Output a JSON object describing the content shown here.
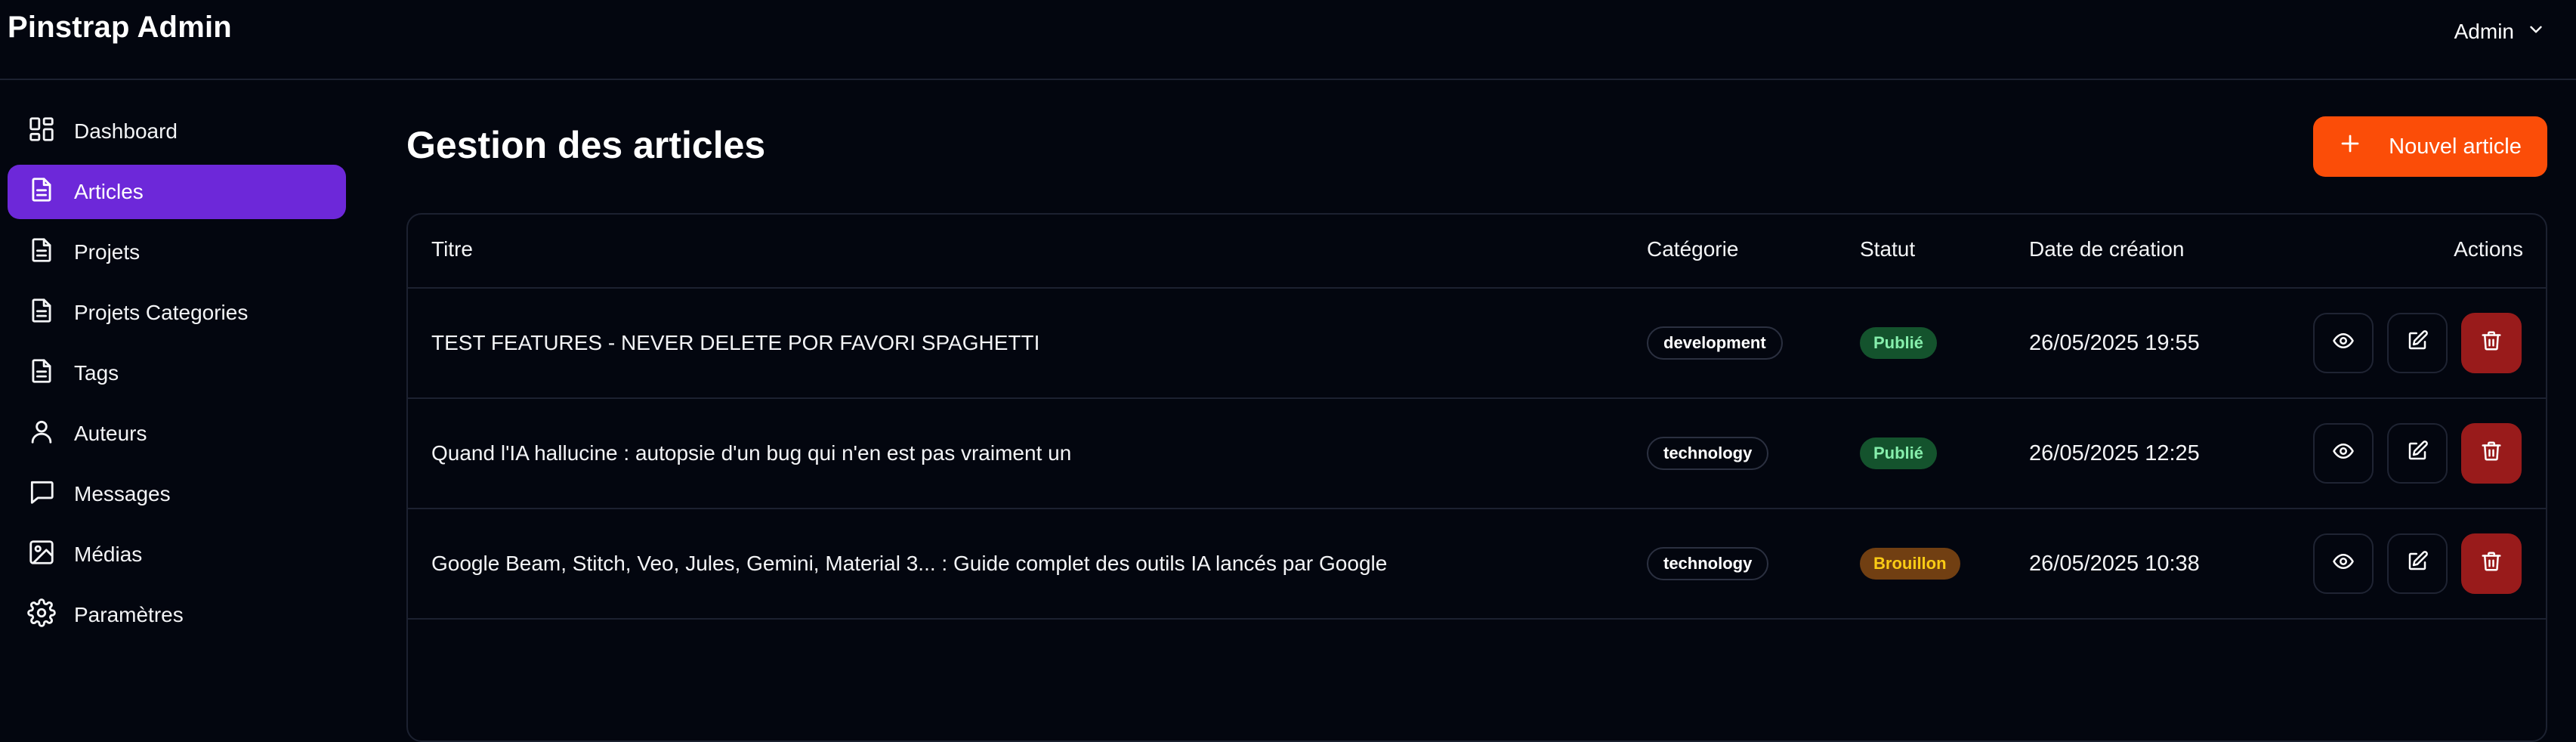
{
  "app": {
    "brand": "Pinstrap Admin"
  },
  "user_menu": {
    "label": "Admin",
    "icon": "chevron-down-icon"
  },
  "sidebar": {
    "items": [
      {
        "label": "Dashboard",
        "icon": "dashboard-grid-icon",
        "active": false
      },
      {
        "label": "Articles",
        "icon": "document-icon",
        "active": true
      },
      {
        "label": "Projets",
        "icon": "document-icon",
        "active": false
      },
      {
        "label": "Projets Categories",
        "icon": "document-icon",
        "active": false
      },
      {
        "label": "Tags",
        "icon": "document-icon",
        "active": false
      },
      {
        "label": "Auteurs",
        "icon": "user-icon",
        "active": false
      },
      {
        "label": "Messages",
        "icon": "chat-bubble-icon",
        "active": false
      },
      {
        "label": "Médias",
        "icon": "image-icon",
        "active": false
      },
      {
        "label": "Paramètres",
        "icon": "gear-icon",
        "active": false
      }
    ]
  },
  "main": {
    "title": "Gestion des articles",
    "new_button_label": "Nouvel article",
    "new_button_icon": "plus-icon"
  },
  "table": {
    "headers": {
      "title": "Titre",
      "category": "Catégorie",
      "status": "Statut",
      "date": "Date de création",
      "actions": "Actions"
    },
    "rows": [
      {
        "title": "TEST FEATURES - NEVER DELETE POR FAVORI SPAGHETTI",
        "category": "development",
        "status": "Publié",
        "status_kind": "published",
        "date": "26/05/2025 19:55"
      },
      {
        "title": "Quand l'IA hallucine : autopsie d'un bug qui n'en est pas vraiment un",
        "category": "technology",
        "status": "Publié",
        "status_kind": "published",
        "date": "26/05/2025 12:25"
      },
      {
        "title": "Google Beam, Stitch, Veo, Jules, Gemini, Material 3... : Guide complet des outils IA lancés par Google",
        "category": "technology",
        "status": "Brouillon",
        "status_kind": "draft",
        "date": "26/05/2025 10:38"
      }
    ],
    "row_actions": [
      "eye-icon",
      "edit-icon",
      "trash-icon"
    ]
  },
  "colors": {
    "background": "#03060f",
    "accent": "#6d28d9",
    "primary_button": "#fb4d08",
    "danger": "#991b1b",
    "published_bg": "#14532d",
    "published_text": "#86efac",
    "draft_bg": "#713f12",
    "draft_text": "#facc15"
  }
}
